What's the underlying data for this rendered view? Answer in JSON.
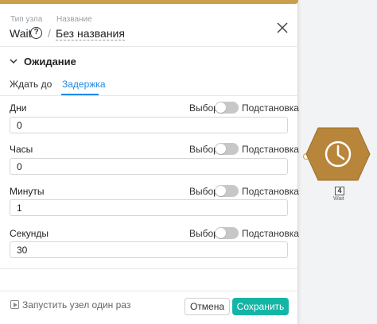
{
  "header": {
    "type_label": "Тип узла",
    "type_value": "Wait",
    "help_icon": "?",
    "name_label": "Название",
    "name_value": "Без названия",
    "slash": "/"
  },
  "section": {
    "title": "Ожидание"
  },
  "tabs": [
    {
      "label": "Ждать до",
      "active": false
    },
    {
      "label": "Задержка",
      "active": true
    }
  ],
  "fields": [
    {
      "label": "Дни",
      "choice_label": "Выбор",
      "subst_label": "Подстановка",
      "value": "0"
    },
    {
      "label": "Часы",
      "choice_label": "Выбор",
      "subst_label": "Подстановка",
      "value": "0"
    },
    {
      "label": "Минуты",
      "choice_label": "Выбор",
      "subst_label": "Подстановка",
      "value": "1"
    },
    {
      "label": "Секунды",
      "choice_label": "Выбор",
      "subst_label": "Подстановка",
      "value": "30"
    }
  ],
  "footer": {
    "run_label": "Запустить узел один раз",
    "cancel_label": "Отмена",
    "save_label": "Сохранить"
  },
  "node": {
    "id": "4",
    "label": "Wait",
    "icon": "clock-icon"
  },
  "colors": {
    "accent": "#1e88e5",
    "save_button": "#15b5a6",
    "node_fill": "#b8863b",
    "toggle_off": "#c7c7c7"
  }
}
